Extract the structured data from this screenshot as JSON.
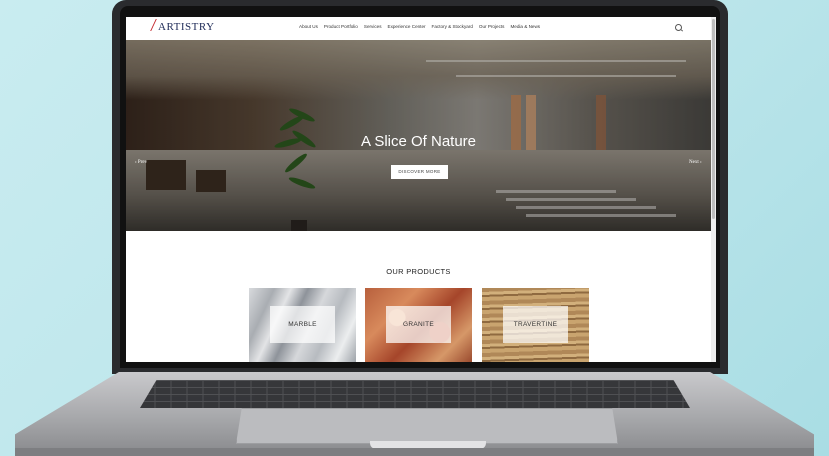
{
  "header": {
    "logo_text": "ARTISTRY",
    "nav": [
      "About Us",
      "Product Portfolio",
      "Services",
      "Experience Center",
      "Factory & Stockyard",
      "Our Projects",
      "Media & News"
    ]
  },
  "hero": {
    "title": "A Slice Of Nature",
    "cta_label": "DISCOVER MORE",
    "prev_label": "‹ Prev",
    "next_label": "Next ›"
  },
  "products": {
    "heading": "OUR PRODUCTS",
    "items": [
      {
        "label": "MARBLE"
      },
      {
        "label": "GRANITE"
      },
      {
        "label": "TRAVERTINE"
      }
    ]
  },
  "icons": {
    "search": "search-icon"
  }
}
